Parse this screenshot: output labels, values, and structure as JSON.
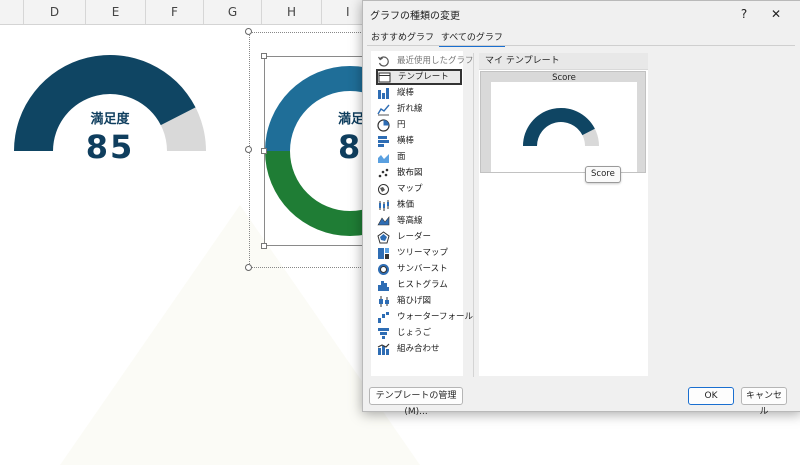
{
  "sheet": {
    "columns": [
      "D",
      "E",
      "F",
      "G",
      "H",
      "I"
    ],
    "gauge_label": "満足度",
    "gauge_value": "85",
    "gauge_value_partial": "8",
    "gauge_label_partial": "満足",
    "score_fraction": 0.85,
    "colors": {
      "navy": "#0f4563",
      "gray": "#d9d9d9",
      "blue": "#1f6e98",
      "green": "#1f7d35"
    }
  },
  "dialog": {
    "title": "グラフの種類の変更",
    "help_label": "?",
    "close_label": "✕",
    "tabs": [
      "おすすめグラフ",
      "すべてのグラフ"
    ],
    "chart_types": [
      {
        "label": "最近使用したグラフ",
        "icon": "recent-icon"
      },
      {
        "label": "テンプレート",
        "icon": "template-folder-icon"
      },
      {
        "label": "縦棒",
        "icon": "column-chart-icon"
      },
      {
        "label": "折れ線",
        "icon": "line-chart-icon"
      },
      {
        "label": "円",
        "icon": "pie-chart-icon"
      },
      {
        "label": "横棒",
        "icon": "bar-chart-icon"
      },
      {
        "label": "面",
        "icon": "area-chart-icon"
      },
      {
        "label": "散布図",
        "icon": "scatter-chart-icon"
      },
      {
        "label": "マップ",
        "icon": "map-chart-icon"
      },
      {
        "label": "株価",
        "icon": "stock-chart-icon"
      },
      {
        "label": "等高線",
        "icon": "surface-chart-icon"
      },
      {
        "label": "レーダー",
        "icon": "radar-chart-icon"
      },
      {
        "label": "ツリーマップ",
        "icon": "treemap-chart-icon"
      },
      {
        "label": "サンバースト",
        "icon": "sunburst-chart-icon"
      },
      {
        "label": "ヒストグラム",
        "icon": "histogram-chart-icon"
      },
      {
        "label": "箱ひげ図",
        "icon": "boxwhisker-chart-icon"
      },
      {
        "label": "ウォーターフォール",
        "icon": "waterfall-chart-icon"
      },
      {
        "label": "じょうご",
        "icon": "funnel-chart-icon"
      },
      {
        "label": "組み合わせ",
        "icon": "combo-chart-icon"
      }
    ],
    "selected_index": 1,
    "section_title": "マイ テンプレート",
    "template_name": "Score",
    "tooltip": "Score",
    "manage_button": "テンプレートの管理(M)...",
    "ok_button": "OK",
    "cancel_button": "キャンセル"
  }
}
